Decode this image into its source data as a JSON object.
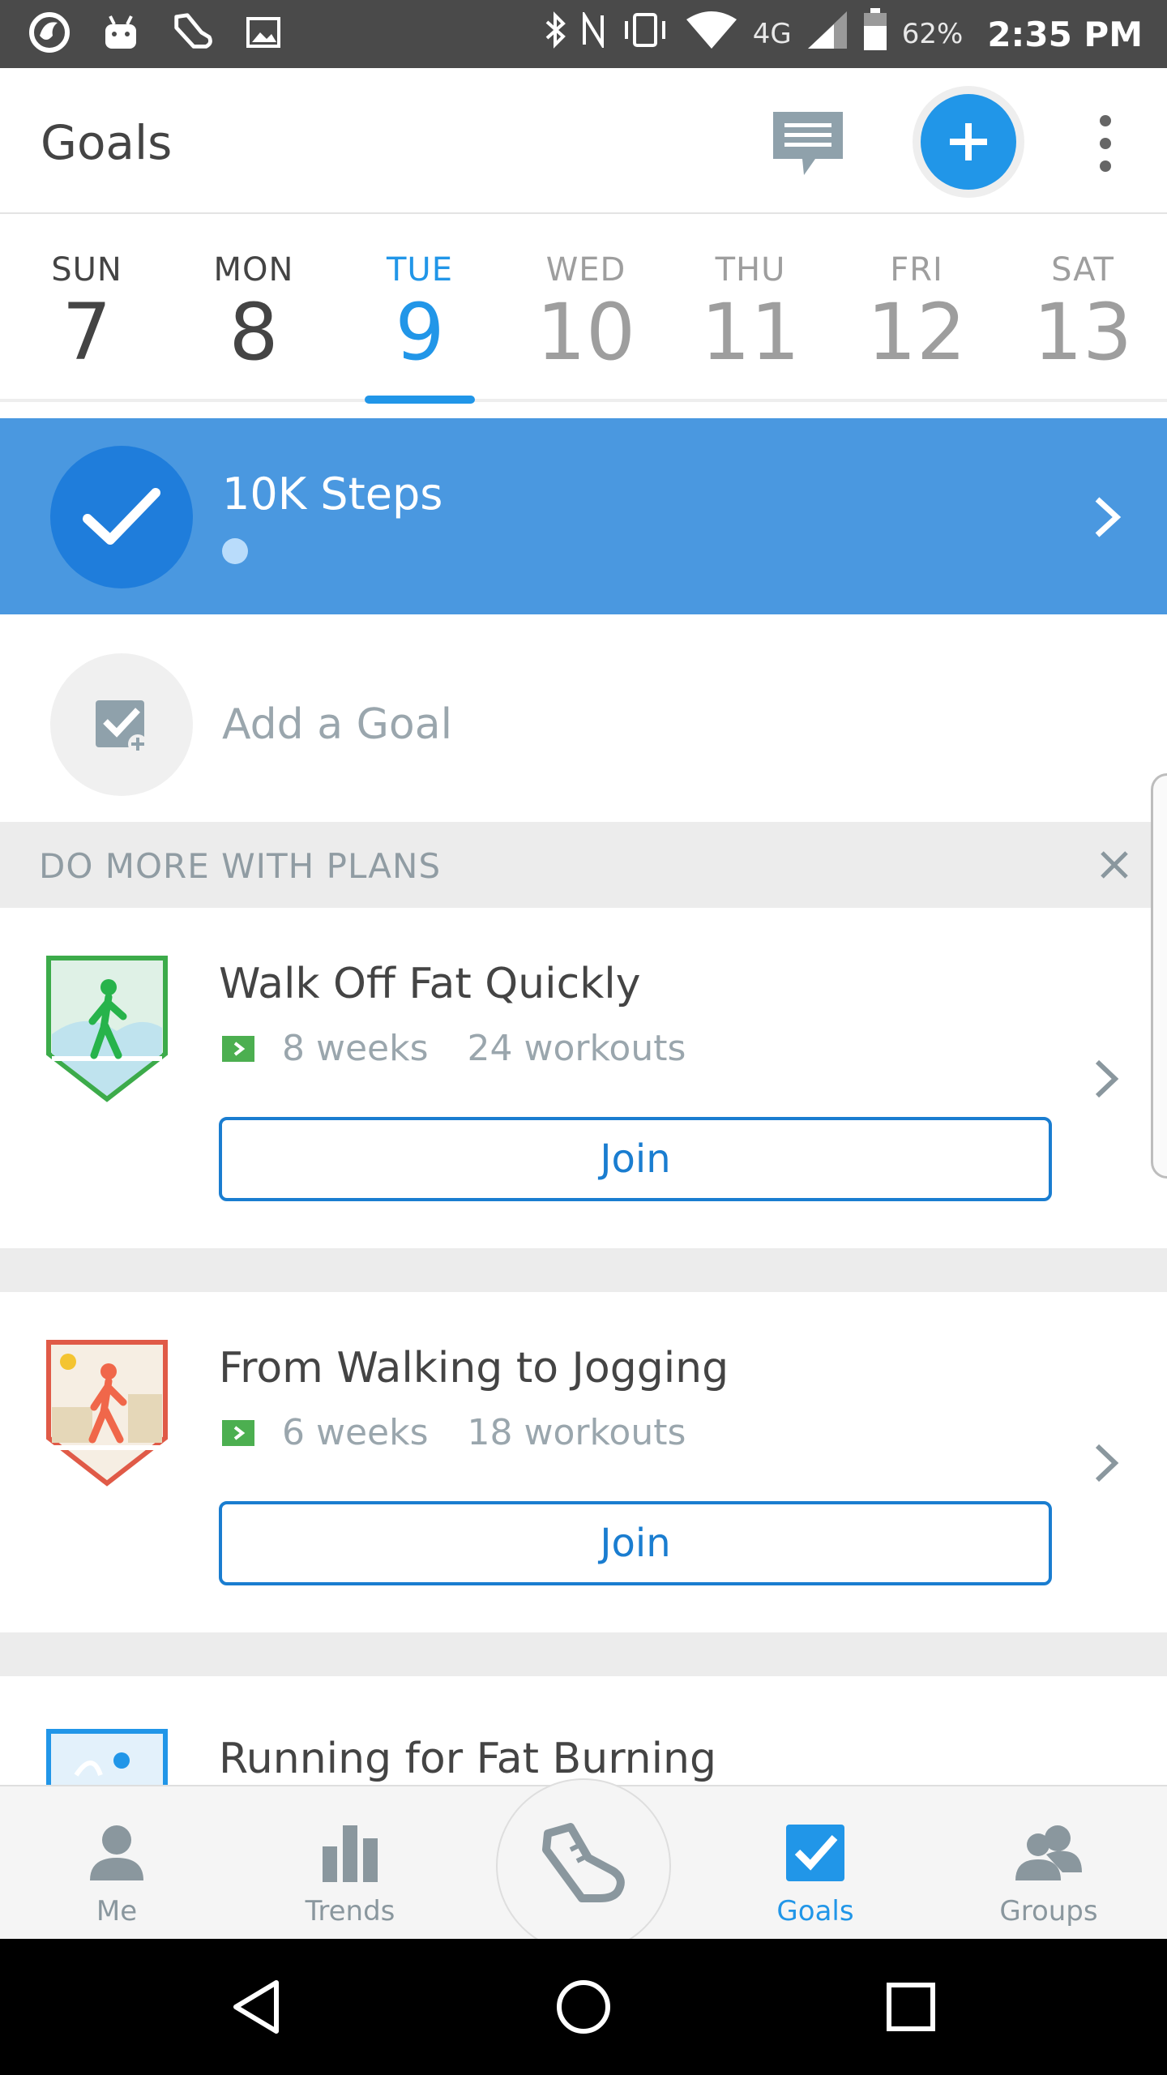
{
  "status_bar": {
    "left_icons": [
      "firefox-icon",
      "android-icon",
      "shoe-icon",
      "image-icon"
    ],
    "right_icons": [
      "bluetooth-icon",
      "nfc-icon",
      "vibrate-icon",
      "wifi-icon",
      "signal-icon",
      "battery-icon"
    ],
    "network": "4G",
    "battery": "62%",
    "time": "2:35 PM"
  },
  "app_bar": {
    "title": "Goals",
    "chat_icon": "chat-icon",
    "add_icon": "plus-icon",
    "more_icon": "more-vert-icon"
  },
  "days": [
    {
      "name": "SUN",
      "num": "7",
      "state": "past"
    },
    {
      "name": "MON",
      "num": "8",
      "state": "past"
    },
    {
      "name": "TUE",
      "num": "9",
      "state": "selected"
    },
    {
      "name": "WED",
      "num": "10",
      "state": "future"
    },
    {
      "name": "THU",
      "num": "11",
      "state": "future"
    },
    {
      "name": "FRI",
      "num": "12",
      "state": "future"
    },
    {
      "name": "SAT",
      "num": "13",
      "state": "future"
    }
  ],
  "goal": {
    "title": "10K Steps",
    "icon": "check-icon"
  },
  "add_goal": {
    "label": "Add a Goal",
    "icon": "add-goal-icon"
  },
  "section": {
    "label": "DO MORE WITH PLANS",
    "close_icon": "close-icon"
  },
  "plans": [
    {
      "title": "Walk Off Fat Quickly",
      "weeks": "8 weeks",
      "workouts": "24 workouts",
      "join": "Join",
      "badge": "walker-badge-icon",
      "badge_color": "#3cab4a"
    },
    {
      "title": "From Walking to Jogging",
      "weeks": "6 weeks",
      "workouts": "18 workouts",
      "join": "Join",
      "badge": "jogger-badge-icon",
      "badge_color": "#e05a47"
    },
    {
      "title": "Running for Fat Burning",
      "badge": "runner-badge-icon",
      "badge_color": "#2196e8"
    }
  ],
  "bottom_nav": {
    "me": "Me",
    "trends": "Trends",
    "goals": "Goals",
    "groups": "Groups",
    "center_icon": "shoe-icon"
  },
  "colors": {
    "accent": "#2196e8",
    "goal_bar": "#4a98e0",
    "status_bar": "#4a4a4a"
  }
}
